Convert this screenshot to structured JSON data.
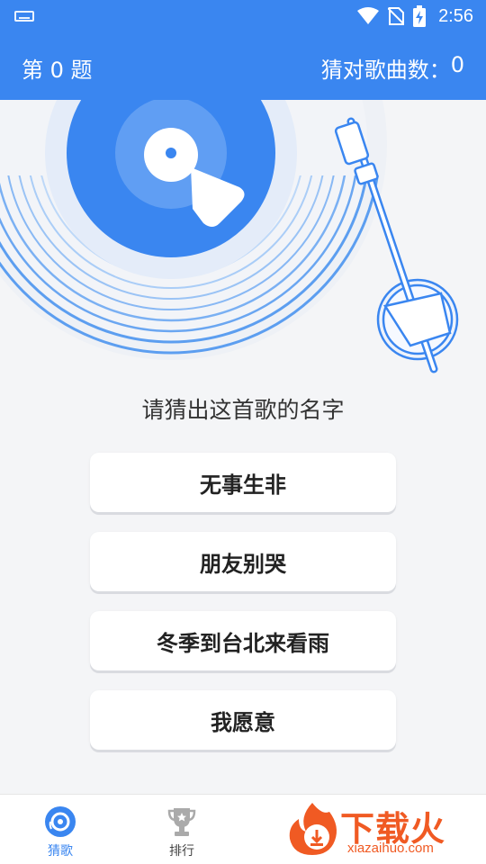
{
  "status_bar": {
    "time": "2:56"
  },
  "header": {
    "question_label": "第 0 题",
    "score_label": "猜对歌曲数：",
    "score_value": "0"
  },
  "prompt": "请猜出这首歌的名字",
  "options": [
    "无事生非",
    "朋友别哭",
    "冬季到台北来看雨",
    "我愿意"
  ],
  "bottom_nav": [
    {
      "label": "猜歌",
      "icon": "disc-icon",
      "active": true
    },
    {
      "label": "排行",
      "icon": "trophy-icon",
      "active": false
    }
  ],
  "watermark": {
    "text": "下载火",
    "url": "xiazaihuo.com"
  },
  "colors": {
    "primary": "#3a86f0",
    "background": "#f4f5f7",
    "watermark": "#f05a23"
  }
}
